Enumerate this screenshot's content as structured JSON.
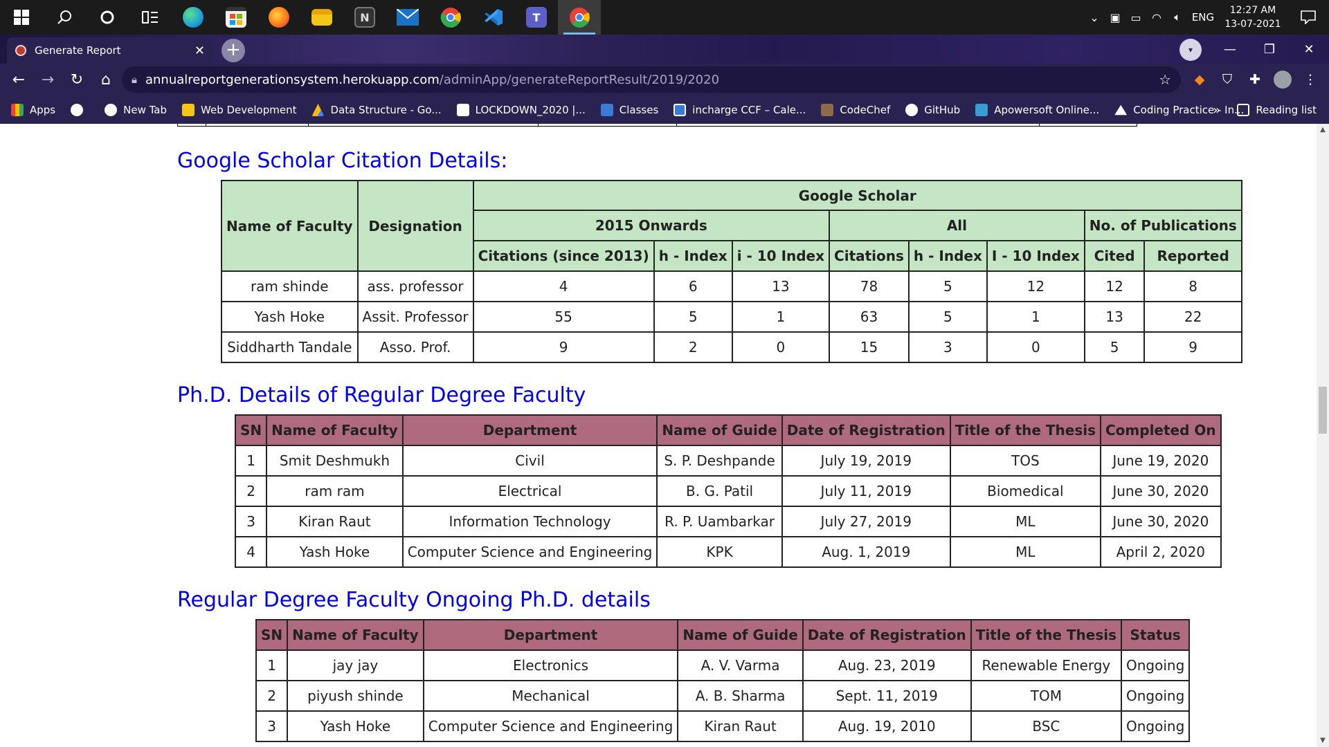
{
  "taskbar": {
    "apps": [
      {
        "name": "start-icon",
        "glyph": "⊞"
      },
      {
        "name": "search-icon",
        "glyph": "⌕"
      },
      {
        "name": "cortana-icon",
        "glyph": "○"
      },
      {
        "name": "task-view-icon",
        "glyph": "▤"
      },
      {
        "name": "edge-icon",
        "color": "#1fa0d8"
      },
      {
        "name": "store-icon",
        "color": "#f0f0f0"
      },
      {
        "name": "firefox-icon",
        "color": "#ff7a1a"
      },
      {
        "name": "file-explorer-icon",
        "color": "#f5c518"
      },
      {
        "name": "notion-icon",
        "color": "#444444"
      },
      {
        "name": "mail-icon",
        "color": "#1a73c8"
      },
      {
        "name": "chrome-icon",
        "color": "#e94235"
      },
      {
        "name": "vscode-icon",
        "color": "#2a8ae2"
      },
      {
        "name": "teams-icon",
        "color": "#5b5fc7"
      },
      {
        "name": "chrome-active-icon",
        "color": "#e94235"
      }
    ],
    "tray_lang": "ENG",
    "time": "12:27 AM",
    "date": "13-07-2021"
  },
  "browser": {
    "tab_title": "Generate Report",
    "url_host": "annualreportgenerationsystem.herokuapp.com",
    "url_path": "/adminApp/generateReportResult/2019/2020",
    "bookmarks": [
      {
        "label": "Apps",
        "icon": "apps-icon",
        "color": "#e8453c"
      },
      {
        "label": "",
        "icon": "globe-icon",
        "color": "#ffffff"
      },
      {
        "label": "New Tab",
        "icon": "globe-icon",
        "color": "#ffffff"
      },
      {
        "label": "Web Development",
        "icon": "folder-icon",
        "color": "#f5c518"
      },
      {
        "label": "Data Structure - Go...",
        "icon": "drive-icon",
        "color": "#f5c518"
      },
      {
        "label": "LOCKDOWN_2020 |...",
        "icon": "bookmark-icon",
        "color": "#ffffff"
      },
      {
        "label": "Classes",
        "icon": "classroom-icon",
        "color": "#3a7bd5"
      },
      {
        "label": "incharge CCF – Cale...",
        "icon": "calendar-icon",
        "color": "#3a7bd5"
      },
      {
        "label": "CodeChef",
        "icon": "codechef-icon",
        "color": "#8b6b4a"
      },
      {
        "label": "GitHub",
        "icon": "github-icon",
        "color": "#ffffff"
      },
      {
        "label": "Apowersoft Online...",
        "icon": "apowersoft-icon",
        "color": "#3a9bd5"
      },
      {
        "label": "Coding Practice - In...",
        "icon": "mountain-icon",
        "color": "#ffffff"
      }
    ],
    "overflow": "»",
    "reading_list": "Reading list"
  },
  "gs": {
    "heading": "Google Scholar Citation Details:",
    "hdr": {
      "name": "Name of Faculty",
      "designation": "Designation",
      "group": "Google Scholar",
      "onwards": "2015 Onwards",
      "all": "All",
      "pubs": "No. of Publications",
      "cit2013": "Citations (since 2013)",
      "h1": "h - Index",
      "i1": "i - 10 Index",
      "cit": "Citations",
      "h2": "h - Index",
      "i2": "I - 10 Index",
      "cited": "Cited",
      "reported": "Reported"
    },
    "rows": [
      [
        "ram shinde",
        "ass. professor",
        "4",
        "6",
        "13",
        "78",
        "5",
        "12",
        "12",
        "8"
      ],
      [
        "Yash Hoke",
        "Assit. Professor",
        "55",
        "5",
        "1",
        "63",
        "5",
        "1",
        "13",
        "22"
      ],
      [
        "Siddharth Tandale",
        "Asso. Prof.",
        "9",
        "2",
        "0",
        "15",
        "3",
        "0",
        "5",
        "9"
      ]
    ]
  },
  "phd": {
    "heading": "Ph.D. Details of Regular Degree Faculty",
    "headers": [
      "SN",
      "Name of Faculty",
      "Department",
      "Name of Guide",
      "Date of Registration",
      "Title of the Thesis",
      "Completed On"
    ],
    "rows": [
      [
        "1",
        "Smit Deshmukh",
        "Civil",
        "S. P. Deshpande",
        "July 19, 2019",
        "TOS",
        "June 19, 2020"
      ],
      [
        "2",
        "ram ram",
        "Electrical",
        "B. G. Patil",
        "July 11, 2019",
        "Biomedical",
        "June 30, 2020"
      ],
      [
        "3",
        "Kiran Raut",
        "Information Technology",
        "R. P. Uambarkar",
        "July 27, 2019",
        "ML",
        "June 30, 2020"
      ],
      [
        "4",
        "Yash Hoke",
        "Computer Science and Engineering",
        "KPK",
        "Aug. 1, 2019",
        "ML",
        "April 2, 2020"
      ]
    ]
  },
  "ongoing": {
    "heading": "Regular Degree Faculty Ongoing Ph.D. details",
    "headers": [
      "SN",
      "Name of Faculty",
      "Department",
      "Name of Guide",
      "Date of Registration",
      "Title of the Thesis",
      "Status"
    ],
    "rows": [
      [
        "1",
        "jay jay",
        "Electronics",
        "A. V. Varma",
        "Aug. 23, 2019",
        "Renewable Energy",
        "Ongoing"
      ],
      [
        "2",
        "piyush shinde",
        "Mechanical",
        "A. B. Sharma",
        "Sept. 11, 2019",
        "TOM",
        "Ongoing"
      ],
      [
        "3",
        "Yash Hoke",
        "Computer Science and Engineering",
        "Kiran Raut",
        "Aug. 19, 2010",
        "BSC",
        "Ongoing"
      ]
    ]
  }
}
